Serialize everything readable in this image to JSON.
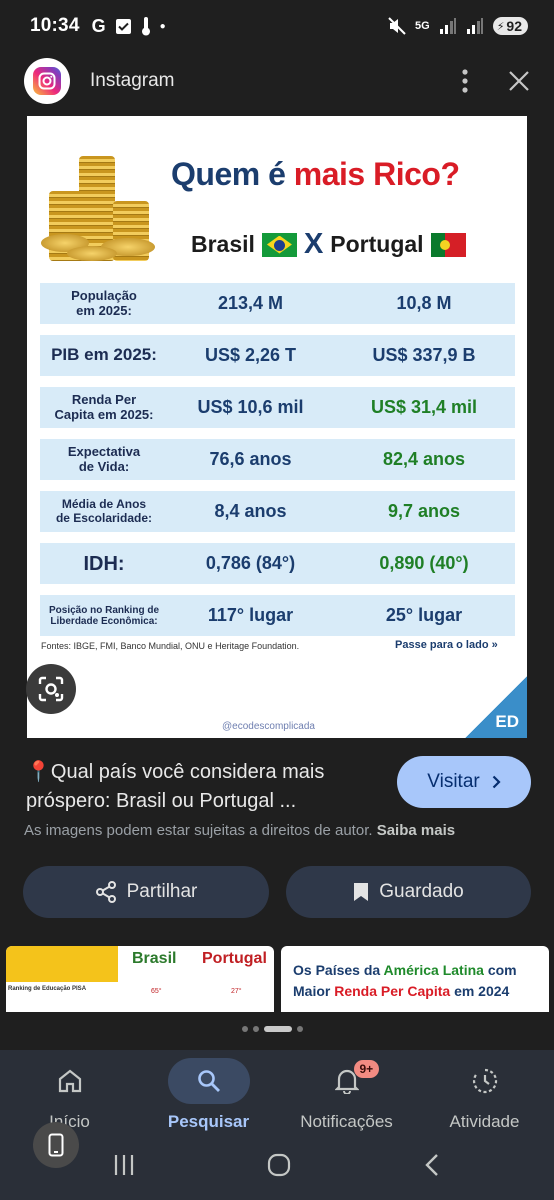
{
  "status_bar": {
    "time": "10:34",
    "carrier_icon": "G",
    "network": "5G",
    "battery": "92"
  },
  "header": {
    "title": "Instagram",
    "icons": [
      "instagram-logo-icon",
      "more-vert-icon",
      "close-icon"
    ]
  },
  "infographic": {
    "title_prefix": "Quem é",
    "title_accent": "mais Rico?",
    "country_a": "Brasil",
    "versus": "X",
    "country_b": "Portugal",
    "colors": {
      "navy": "#1b3d6e",
      "red": "#d91c26",
      "green": "#1f7f26",
      "row_bg": "#d8ebf8"
    },
    "rows": [
      {
        "label": "População\nem 2025:",
        "brasil": "213,4 M",
        "portugal": "10,8 M"
      },
      {
        "label": "PIB em 2025:",
        "brasil": "US$ 2,26 T",
        "portugal": "US$ 337,9 B"
      },
      {
        "label": "Renda Per\nCapita em 2025:",
        "brasil": "US$ 10,6 mil",
        "portugal": "US$ 31,4 mil"
      },
      {
        "label": "Expectativa\nde Vida:",
        "brasil": "76,6 anos",
        "portugal": "82,4 anos"
      },
      {
        "label": "Média de Anos\nde Escolaridade:",
        "brasil": "8,4 anos",
        "portugal": "9,7 anos"
      },
      {
        "label": "IDH:",
        "brasil": "0,786 (84°)",
        "portugal": "0,890 (40°)"
      },
      {
        "label": "Posição no Ranking de\nLiberdade Econômica:",
        "brasil": "117° lugar",
        "portugal": "25° lugar"
      }
    ],
    "sources": "Fontes: IBGE, FMI, Banco Mundial, ONU e Heritage Foundation.",
    "swipe_hint": "Passe para o lado",
    "handle": "@ecodescomplicada",
    "brand_badge": "ED"
  },
  "result": {
    "title": "📍Qual país você considera mais próspero: Brasil ou Portugal ...",
    "visit_label": "Visitar",
    "copyright_text": "As imagens podem estar sujeitas a direitos de autor.",
    "learn_more": "Saiba mais",
    "share_label": "Partilhar",
    "saved_label": "Guardado"
  },
  "related": {
    "left": {
      "header_brasil": "Brasil",
      "header_portugal": "Portugal",
      "row_label": "Ranking de Educação PISA",
      "value_brasil": "65°",
      "value_portugal": "27°"
    },
    "right": {
      "line1_prefix": "Os Países da",
      "line1_accent": "América Latina",
      "line1_suffix": "com",
      "line2_prefix": "Maior",
      "line2_accent": "Renda Per Capita",
      "line2_suffix": "em 2024"
    }
  },
  "bottom_nav": {
    "items": [
      {
        "label": "Início",
        "icon": "home-icon"
      },
      {
        "label": "Pesquisar",
        "icon": "search-icon"
      },
      {
        "label": "Notificações",
        "icon": "bell-icon",
        "badge": "9+"
      },
      {
        "label": "Atividade",
        "icon": "activity-icon"
      }
    ]
  }
}
